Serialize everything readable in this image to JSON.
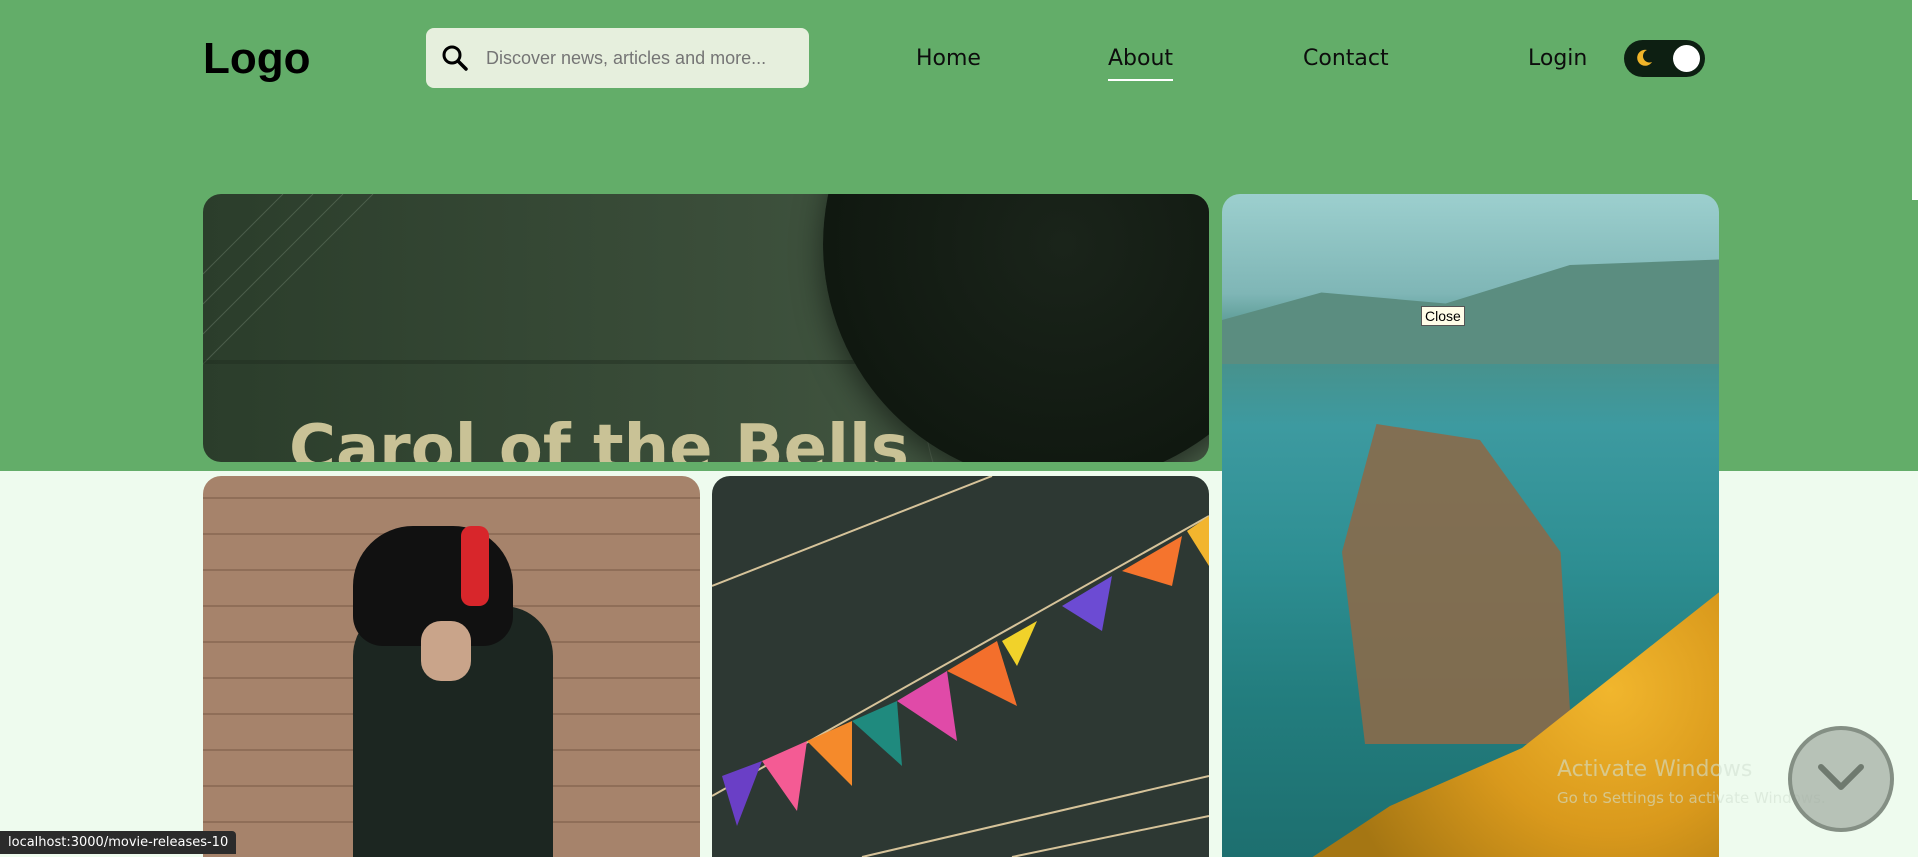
{
  "header": {
    "logo": "Logo",
    "search": {
      "placeholder": "Discover news, articles and more..."
    },
    "nav": {
      "home": "Home",
      "about": "About",
      "contact": "Contact",
      "login": "Login"
    },
    "theme_toggle": {
      "state": "dark-mode-on"
    }
  },
  "gallery": {
    "feature_title": "Carol of the Bells",
    "close_label": "Close"
  },
  "status_bar": {
    "url": "localhost:3000/movie-releases-10"
  },
  "watermark": {
    "title": "Activate Windows",
    "subtitle": "Go to Settings to activate Windows."
  },
  "colors": {
    "header_bg": "#63ad69",
    "page_bg": "#eefbee",
    "search_bg": "#e6efdd",
    "toggle_bg": "#0d1f12",
    "feature_title": "#c9c296"
  },
  "icons": {
    "search": "search-icon",
    "moon": "moon-icon",
    "scroll": "chevron-down-icon"
  }
}
